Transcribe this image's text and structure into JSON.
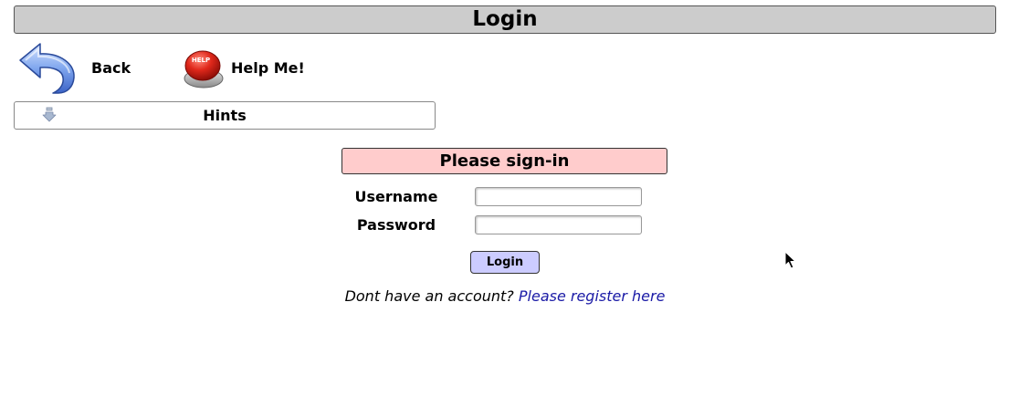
{
  "header": {
    "title": "Login"
  },
  "nav": {
    "back_label": "Back",
    "back_icon": "back-arrow-icon",
    "help_label": "Help Me!",
    "help_icon": "help-button-icon",
    "help_icon_text": "HELP"
  },
  "hints": {
    "label": "Hints",
    "icon": "down-arrow-icon"
  },
  "form": {
    "heading": "Please sign-in",
    "username_label": "Username",
    "username_value": "",
    "password_label": "Password",
    "password_value": "",
    "submit_label": "Login"
  },
  "register": {
    "prompt": "Dont have an account?",
    "link_text": "Please register here"
  },
  "colors": {
    "title_bar": "#cccccc",
    "signin_header": "#ffcccc",
    "login_button": "#ccccff",
    "link": "#1a1aa6"
  }
}
